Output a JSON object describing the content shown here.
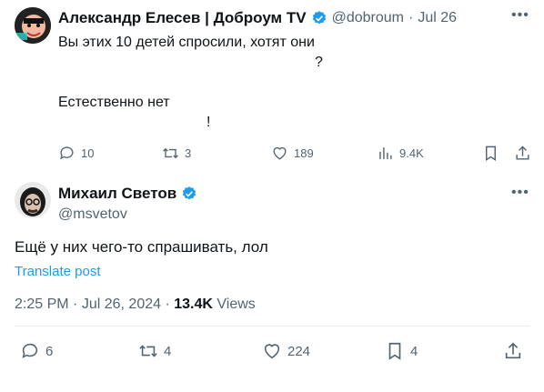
{
  "parent": {
    "author_name": "Александр Елесев | Доброум TV",
    "handle": "@dobroum",
    "dot": "·",
    "date": "Jul 26",
    "text_line1": "Вы этих 10 детей спросили, хотят они",
    "text_line2": "?",
    "text_line3": "Естественно нет",
    "text_line4": "!",
    "actions": {
      "replies": "10",
      "reposts": "3",
      "likes": "189",
      "views": "9.4K"
    }
  },
  "reply": {
    "author_name": "Михаил Светов",
    "handle": "@msvetov",
    "text": "Ещё у них чего-то спрашивать, лол",
    "translate": "Translate post",
    "time": "2:25 PM",
    "date": "Jul 26, 2024",
    "views_count": "13.4K",
    "views_label": "Views",
    "actions": {
      "replies": "6",
      "reposts": "4",
      "likes": "224",
      "bookmarks": "4"
    }
  },
  "colors": {
    "verified": "#1d9bf0",
    "muted": "#536471",
    "link": "#1d9bf0"
  }
}
